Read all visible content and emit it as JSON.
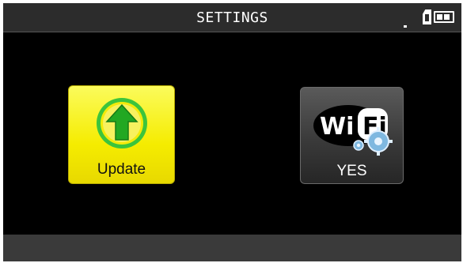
{
  "header": {
    "title": "SETTINGS",
    "icons": [
      "signal-dot-icon",
      "sd-card-icon",
      "battery-icon"
    ]
  },
  "tiles": [
    {
      "label": "Update",
      "icon": "update-arrow-icon",
      "color": "#f5ec00"
    },
    {
      "label": "YES",
      "icon": "wifi-settings-icon",
      "color": "#3a3a3a"
    }
  ],
  "colors": {
    "background": "#000000",
    "header": "#2c2c2c",
    "footer": "#3a3a3a",
    "accent_green": "#3cc43c"
  }
}
